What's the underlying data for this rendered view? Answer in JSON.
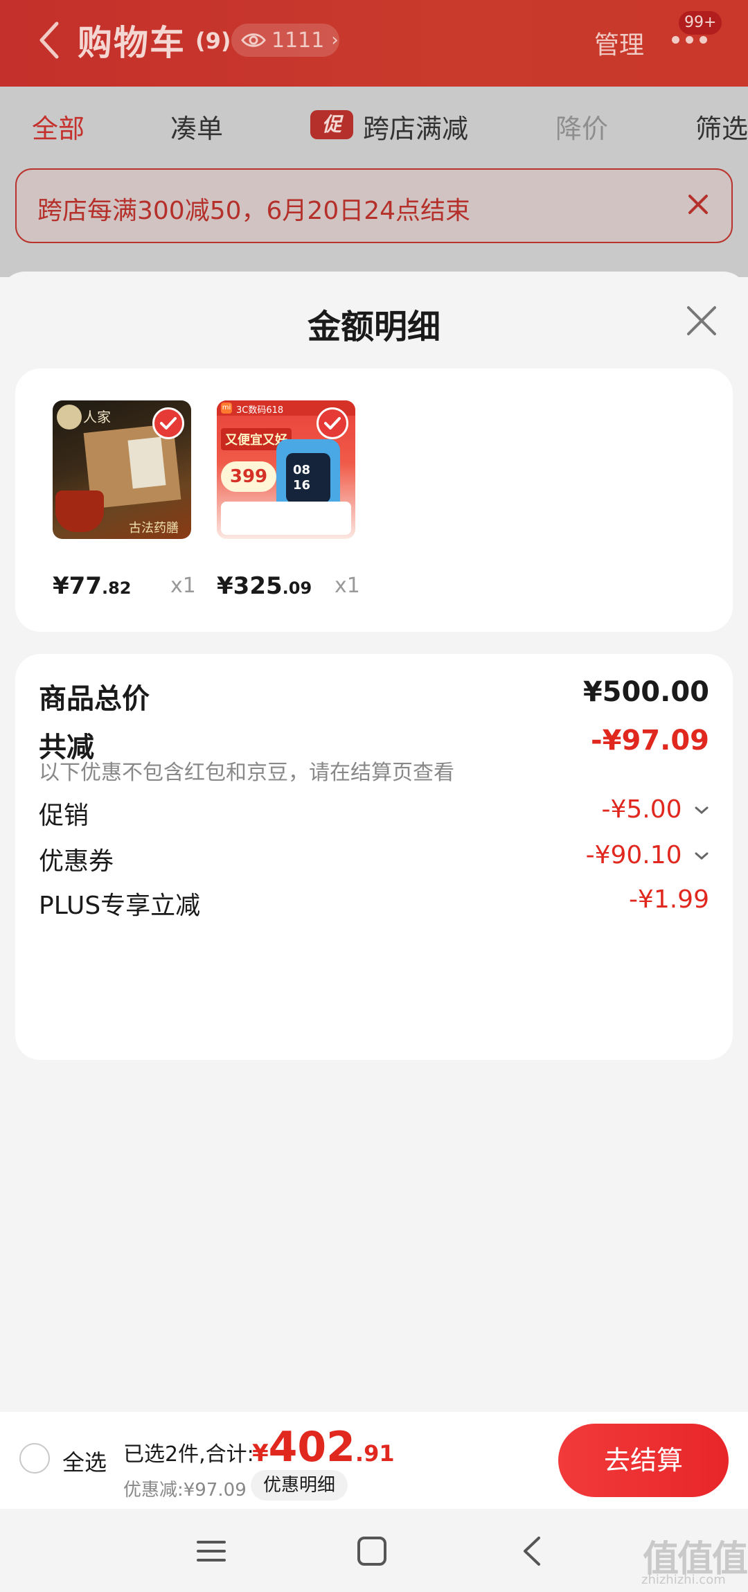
{
  "cart": {
    "title": "购物车",
    "count": "(9)",
    "views": "1111",
    "manage": "管理",
    "badge": "99+",
    "tabs": {
      "all": "全部",
      "bundle": "凑单",
      "promo_tag": "促",
      "cross_store": "跨店满减",
      "price_drop": "降价",
      "filter": "筛选"
    },
    "notice": "跨店每满300减50，6月20日24点结束"
  },
  "sheet": {
    "title": "金额明细",
    "items": [
      {
        "price_int": "¥77",
        "price_dec": ".82",
        "qty": "x1",
        "brand": "人家",
        "caption": "古法药膳"
      },
      {
        "price_int": "¥325",
        "price_dec": ".09",
        "qty": "x1",
        "strip_label": "3C数码618",
        "headline": "又便宜又好",
        "price_burst": "399",
        "screen_time": "08 16"
      }
    ],
    "summary": {
      "total_label": "商品总价",
      "total_value": "¥500.00",
      "reduce_label": "共减",
      "reduce_value": "-¥97.09",
      "note": "以下优惠不包含红包和京豆，请在结算页查看",
      "promo_label": "促销",
      "promo_value": "-¥5.00",
      "coupon_label": "优惠券",
      "coupon_value": "-¥90.10",
      "plus_label": "PLUS专享立减",
      "plus_value": "-¥1.99"
    }
  },
  "checkout": {
    "select_all": "全选",
    "selected_info": "已选2件,合计:",
    "total_currency": "¥",
    "total_int": "402",
    "total_dec": ".91",
    "discount_info": "优惠减:¥97.09",
    "detail_label": "优惠明细",
    "pay_label": "去结算"
  },
  "watermark": {
    "text": "值值值",
    "sub": "zhizhizhi.com"
  },
  "colors": {
    "accent": "#e0281f",
    "header_red": "#c4302b"
  }
}
